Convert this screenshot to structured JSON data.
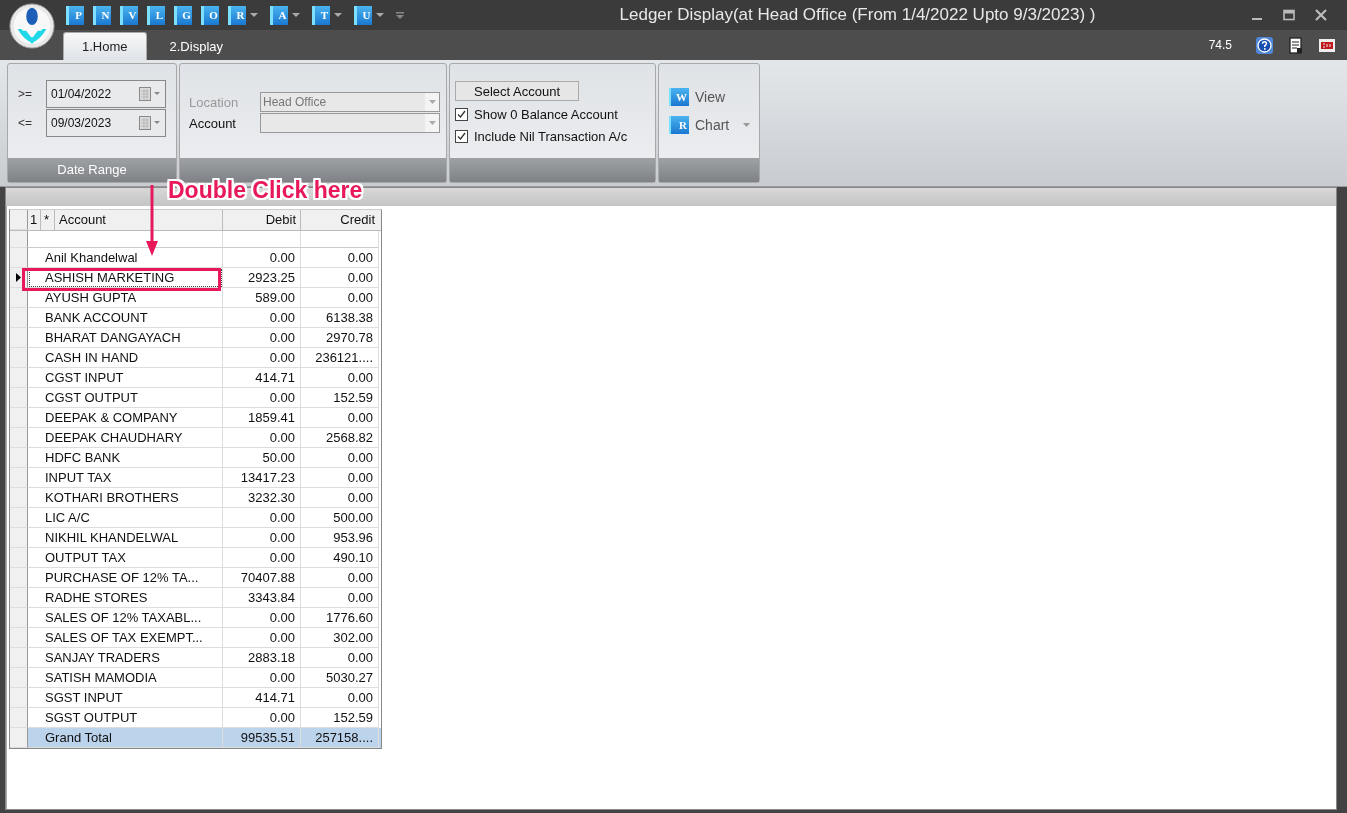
{
  "window": {
    "title": "Ledger Display(at Head Office  (From 1/4/2022 Upto 9/3/2023) )"
  },
  "quick_access": [
    {
      "letter": "P",
      "dropdown": false
    },
    {
      "letter": "N",
      "dropdown": false
    },
    {
      "letter": "V",
      "dropdown": false
    },
    {
      "letter": "L",
      "dropdown": false
    },
    {
      "letter": "G",
      "dropdown": false
    },
    {
      "letter": "O",
      "dropdown": false
    },
    {
      "letter": "R",
      "dropdown": true
    },
    {
      "letter": "A",
      "dropdown": true
    },
    {
      "letter": "T",
      "dropdown": true
    },
    {
      "letter": "U",
      "dropdown": true
    }
  ],
  "tabs": [
    {
      "label": "1.Home",
      "selected": true
    },
    {
      "label": "2.Display",
      "selected": false
    }
  ],
  "zoom_value": "74.5",
  "date_range": {
    "caption": "Date Range",
    "fields": [
      {
        "operator": ">=",
        "value": "01/04/2022"
      },
      {
        "operator": "<=",
        "value": "09/03/2023"
      }
    ]
  },
  "filters": [
    {
      "label": "Location",
      "value": "Head Office",
      "disabled": true
    },
    {
      "label": "Account",
      "disabled": false
    }
  ],
  "options": {
    "button": "Select Account",
    "checkboxes": [
      {
        "label": "Show 0 Balance Account",
        "checked": true
      },
      {
        "label": "Include Nil Transaction A/c",
        "checked": true
      }
    ]
  },
  "actions": [
    {
      "label": "View",
      "icon_letter": "W",
      "dropdown": false
    },
    {
      "label": "Chart",
      "icon_letter": "R",
      "dropdown": true
    }
  ],
  "annotation": {
    "text": "Double Click here"
  },
  "table": {
    "columns": [
      "1",
      "*",
      "Account",
      "Debit",
      "Credit"
    ],
    "rows": [
      {
        "account": "Anil Khandelwal",
        "debit": "0.00",
        "credit": "0.00",
        "current": false
      },
      {
        "account": "ASHISH MARKETING",
        "debit": "2923.25",
        "credit": "0.00",
        "current": true
      },
      {
        "account": "AYUSH GUPTA",
        "debit": "589.00",
        "credit": "0.00",
        "current": false
      },
      {
        "account": "BANK ACCOUNT",
        "debit": "0.00",
        "credit": "6138.38",
        "current": false
      },
      {
        "account": "BHARAT DANGAYACH",
        "debit": "0.00",
        "credit": "2970.78",
        "current": false
      },
      {
        "account": "CASH IN HAND",
        "debit": "0.00",
        "credit": "236121....",
        "current": false
      },
      {
        "account": "CGST INPUT",
        "debit": "414.71",
        "credit": "0.00",
        "current": false
      },
      {
        "account": "CGST OUTPUT",
        "debit": "0.00",
        "credit": "152.59",
        "current": false
      },
      {
        "account": "DEEPAK & COMPANY",
        "debit": "1859.41",
        "credit": "0.00",
        "current": false
      },
      {
        "account": "DEEPAK CHAUDHARY",
        "debit": "0.00",
        "credit": "2568.82",
        "current": false
      },
      {
        "account": "HDFC BANK",
        "debit": "50.00",
        "credit": "0.00",
        "current": false
      },
      {
        "account": "INPUT TAX",
        "debit": "13417.23",
        "credit": "0.00",
        "current": false
      },
      {
        "account": "KOTHARI BROTHERS",
        "debit": "3232.30",
        "credit": "0.00",
        "current": false
      },
      {
        "account": "LIC A/C",
        "debit": "0.00",
        "credit": "500.00",
        "current": false
      },
      {
        "account": "NIKHIL KHANDELWAL",
        "debit": "0.00",
        "credit": "953.96",
        "current": false
      },
      {
        "account": "OUTPUT TAX",
        "debit": "0.00",
        "credit": "490.10",
        "current": false
      },
      {
        "account": "PURCHASE OF 12% TA...",
        "debit": "70407.88",
        "credit": "0.00",
        "current": false
      },
      {
        "account": "RADHE STORES",
        "debit": "3343.84",
        "credit": "0.00",
        "current": false
      },
      {
        "account": "SALES OF 12% TAXABL...",
        "debit": "0.00",
        "credit": "1776.60",
        "current": false
      },
      {
        "account": "SALES OF TAX EXEMPT...",
        "debit": "0.00",
        "credit": "302.00",
        "current": false
      },
      {
        "account": "SANJAY TRADERS",
        "debit": "2883.18",
        "credit": "0.00",
        "current": false
      },
      {
        "account": "SATISH MAMODIA",
        "debit": "0.00",
        "credit": "5030.27",
        "current": false
      },
      {
        "account": "SGST INPUT",
        "debit": "414.71",
        "credit": "0.00",
        "current": false
      },
      {
        "account": "SGST OUTPUT",
        "debit": "0.00",
        "credit": "152.59",
        "current": false
      }
    ],
    "total": {
      "account": "Grand Total",
      "debit": "99535.51",
      "credit": "257158...."
    }
  }
}
